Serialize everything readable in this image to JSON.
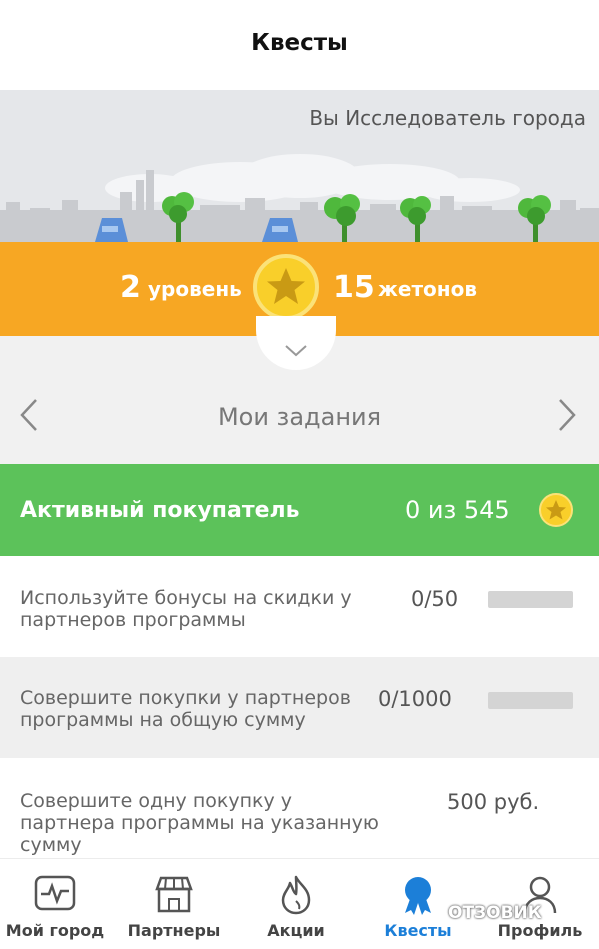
{
  "header": {
    "title": "Квесты"
  },
  "banner": {
    "status": "Вы Исследователь города"
  },
  "level": {
    "level_number": "2",
    "level_label": "уровень",
    "tokens_number": "15",
    "tokens_label": "жетонов"
  },
  "tasks_nav": {
    "label": "Мои задания"
  },
  "quest": {
    "name": "Активный покупатель",
    "progress": "0 из 545"
  },
  "tasks": [
    {
      "desc": "Используйте бонусы на скидки у партнеров программы",
      "value": "0/50",
      "progress": 0
    },
    {
      "desc": "Совершите покупки у партнеров программы на общую сумму",
      "value": "0/1000",
      "progress": 0
    },
    {
      "desc": "Совершите одну покупку у партнера программы на указанную сумму",
      "value": "500 руб."
    }
  ],
  "tabbar": {
    "items": [
      {
        "label": "Мой город",
        "icon": "pulse-icon"
      },
      {
        "label": "Партнеры",
        "icon": "shop-icon"
      },
      {
        "label": "Акции",
        "icon": "flame-icon"
      },
      {
        "label": "Квесты",
        "icon": "medal-icon",
        "active": true
      },
      {
        "label": "Профиль",
        "icon": "user-icon"
      }
    ]
  },
  "watermark": "ОТЗОВИК",
  "colors": {
    "orange": "#f7a723",
    "green": "#5cc25a",
    "active_tab": "#1c7fd8",
    "coin": "#f9cf2a"
  }
}
